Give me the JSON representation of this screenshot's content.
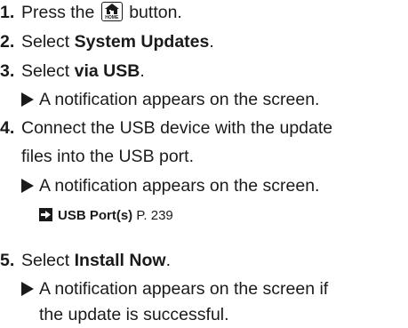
{
  "steps": [
    {
      "num": "1.",
      "pre": "Press the",
      "icon": "home-icon",
      "icon_label": "HOME",
      "post": " button."
    },
    {
      "num": "2.",
      "pre": "Select ",
      "bold": "System Updates",
      "post": "."
    },
    {
      "num": "3.",
      "pre": "Select ",
      "bold": "via USB",
      "post": "."
    },
    {
      "num": "4.",
      "line1": "Connect the USB device with the update",
      "line2": "files into the USB port."
    },
    {
      "num": "5.",
      "pre": "Select ",
      "bold": "Install Now",
      "post": "."
    }
  ],
  "notes": {
    "step3": "A notification appears on the screen.",
    "step4": "A notification appears on the screen.",
    "step5_line1": "A notification appears on the screen if",
    "step5_line2": "the update is successful."
  },
  "xref": {
    "icon": "arrow-right-icon",
    "label": "USB Port(s)",
    "page": " P. 239"
  }
}
